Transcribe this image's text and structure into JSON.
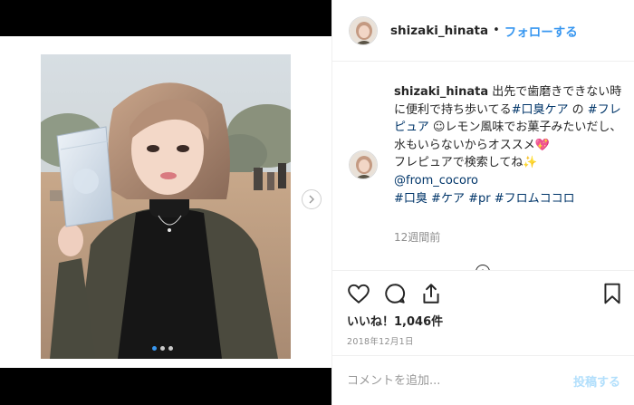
{
  "header": {
    "username": "shizaki_hinata",
    "separator": "•",
    "follow_label": "フォローする"
  },
  "caption": {
    "username": "shizaki_hinata",
    "text_1": " 出先で歯磨きできない時に便利で持ち歩いてる",
    "tag_1": "#口臭ケア",
    "text_2": " の ",
    "tag_2": "#フレピュア",
    "text_3": " ☺レモン風味でお菓子みたいだし、水もいらないからオススメ",
    "emoji_heart": "💖",
    "line_2": "フレピュアで検索してね",
    "emoji_sparkle": "✨",
    "mention": "@from_cocoro",
    "tags_line": [
      "#口臭",
      "#ケア",
      "#pr",
      "#フロムココロ"
    ]
  },
  "time_ago": "12週間前",
  "likes_text": "いいね！1,046件",
  "date_text": "2018年12月1日",
  "comment_box": {
    "placeholder": "コメントを追加...",
    "post_label": "投稿する"
  },
  "carousel": {
    "count": 3,
    "active_index": 0
  },
  "icons": {
    "like": "heart-icon",
    "comment": "comment-bubble-icon",
    "share": "share-icon",
    "save": "bookmark-icon",
    "next": "chevron-right-icon",
    "load_more": "plus-circle-icon"
  },
  "colors": {
    "link": "#3897f0",
    "hashtag": "#003569",
    "muted": "#8e8e8e",
    "text": "#262626",
    "post_disabled": "#b2dffc"
  }
}
